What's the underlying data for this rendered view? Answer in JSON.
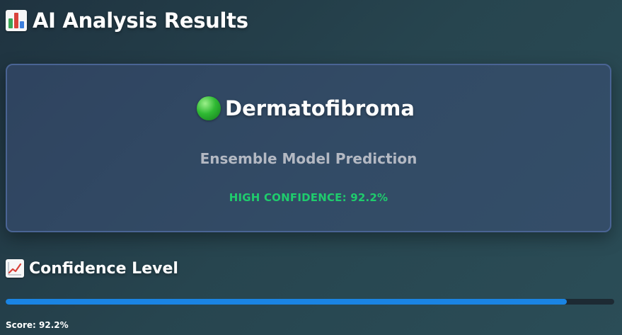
{
  "header": {
    "icon": "bar-chart-icon",
    "title": "AI Analysis Results"
  },
  "result_card": {
    "status_icon": "green-circle-icon",
    "diagnosis": "Dermatofibroma",
    "subtitle": "Ensemble Model Prediction",
    "confidence_text": "HIGH CONFIDENCE: 92.2%"
  },
  "confidence_section": {
    "icon": "chart-increasing-icon",
    "title": "Confidence Level",
    "progress_percent": 92.2,
    "score_text": "Score: 92.2%"
  },
  "colors": {
    "confidence_green": "#1fcc6d",
    "progress_blue": "#1a84e3",
    "progress_track": "#1d2a33",
    "card_border": "#4a6494"
  }
}
